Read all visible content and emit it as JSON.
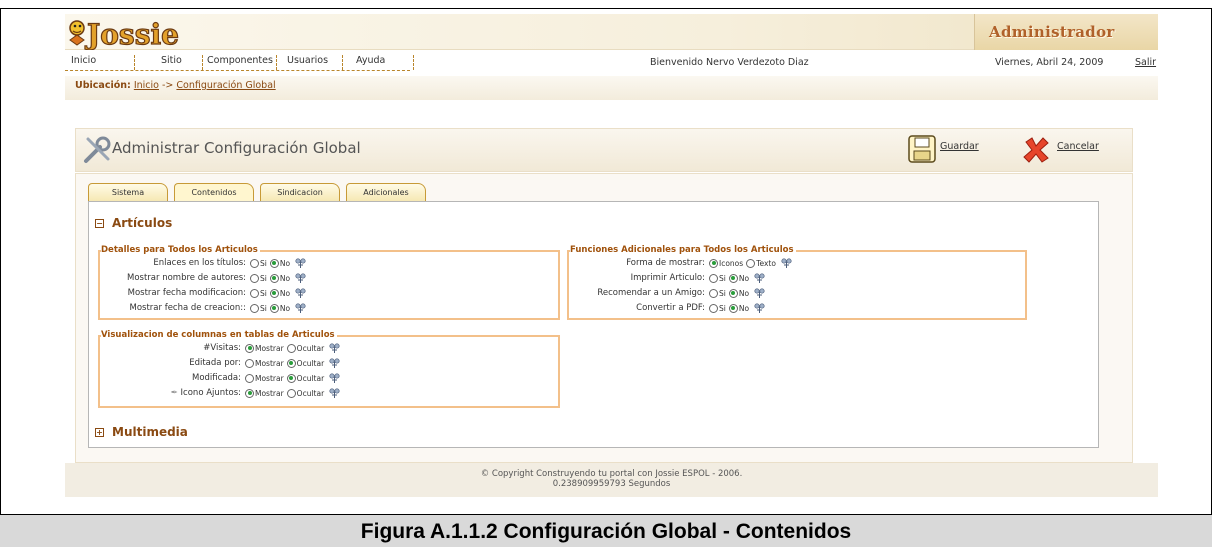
{
  "header": {
    "logo_text": "Jossie",
    "admin_label": "Administrador"
  },
  "nav": {
    "items": [
      "Inicio",
      "Sitio",
      "Componentes",
      "Usuarios",
      "Ayuda"
    ],
    "welcome": "Bienvenido Nervo Verdezoto Diaz",
    "date": "Viernes, Abril 24, 2009",
    "logout": "Salir"
  },
  "breadcrumb": {
    "label": "Ubicación:",
    "home": "Inicio",
    "separator": "->",
    "current": "Configuración Global"
  },
  "panel": {
    "title": "Administrar Configuración Global",
    "save": "Guardar",
    "cancel": "Cancelar"
  },
  "tabs": [
    "Sistema",
    "Contenidos",
    "Sindicacion",
    "Adicionales"
  ],
  "active_tab": "Contenidos",
  "sections": {
    "articulos": "Artículos",
    "multimedia": "Multimedia"
  },
  "fieldsets": {
    "detalles": {
      "legend": "Detalles para Todos los Articulos",
      "rows": [
        {
          "label": "Enlaces en los títulos:",
          "options": [
            "Si",
            "No"
          ],
          "selected": "No"
        },
        {
          "label": "Mostrar nombre de autores:",
          "options": [
            "Si",
            "No"
          ],
          "selected": "No"
        },
        {
          "label": "Mostrar fecha modificacion:",
          "options": [
            "Si",
            "No"
          ],
          "selected": "No"
        },
        {
          "label": "Mostrar fecha de creacion::",
          "options": [
            "Si",
            "No"
          ],
          "selected": "No"
        }
      ]
    },
    "funciones": {
      "legend": "Funciones Adicionales para Todos los Articulos",
      "rows": [
        {
          "label": "Forma de mostrar:",
          "options": [
            "Iconos",
            "Texto"
          ],
          "selected": "Iconos"
        },
        {
          "label": "Imprimir Articulo:",
          "options": [
            "Si",
            "No"
          ],
          "selected": "No"
        },
        {
          "label": "Recomendar a un Amigo:",
          "options": [
            "Si",
            "No"
          ],
          "selected": "No"
        },
        {
          "label": "Convertir a PDF:",
          "options": [
            "Si",
            "No"
          ],
          "selected": "No"
        }
      ]
    },
    "visualizacion": {
      "legend": "Visualizacion de columnas en tablas de Articulos",
      "rows": [
        {
          "label": "#Visitas:",
          "options": [
            "Mostrar",
            "Ocultar"
          ],
          "selected": "Mostrar"
        },
        {
          "label": "Editada por:",
          "options": [
            "Mostrar",
            "Ocultar"
          ],
          "selected": "Ocultar"
        },
        {
          "label": "Modificada:",
          "options": [
            "Mostrar",
            "Ocultar"
          ],
          "selected": "Ocultar"
        },
        {
          "label": "Icono Ajuntos:",
          "options": [
            "Mostrar",
            "Ocultar"
          ],
          "selected": "Mostrar"
        }
      ]
    }
  },
  "footer": {
    "line1": "© Copyright Construyendo tu portal con Jossie ESPOL - 2006.",
    "line2": "0.238909959793 Segundos"
  },
  "caption": "Figura A.1.1.2 Configuración Global - Contenidos",
  "colors": {
    "accent": "#8a4a12",
    "tab_border": "#c79a37",
    "fieldset_border": "#f3c08a",
    "caption_bg": "#d9d9d9"
  }
}
